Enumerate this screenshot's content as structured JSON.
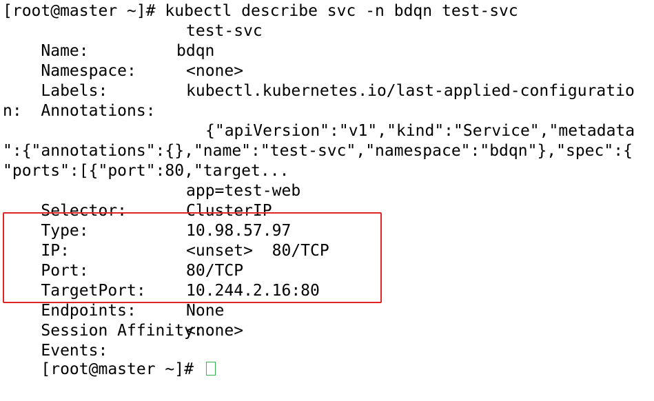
{
  "terminal": {
    "command_line": "[root@master ~]# kubectl describe svc -n bdqn test-svc",
    "fields": {
      "name_label": "Name:",
      "name_value": "test-svc",
      "namespace_label": "Namespace:",
      "namespace_value": "bdqn",
      "labels_label": "Labels:",
      "labels_value": "<none>",
      "annotations_label": "Annotations:",
      "annotations_value": "kubectl.kubernetes.io/last-applied-configuratio",
      "annotations_wrap": "n:",
      "annotation_json_1": "{\"apiVersion\":\"v1\",\"kind\":\"Service\",\"metadata",
      "annotation_json_2": "\":{\"annotations\":{},\"name\":\"test-svc\",\"namespace\":\"bdqn\"},\"spec\":{",
      "annotation_json_3": "\"ports\":[{\"port\":80,\"target...",
      "selector_label": "Selector:",
      "selector_value": "app=test-web",
      "type_label": "Type:",
      "type_value": "ClusterIP",
      "ip_label": "IP:",
      "ip_value": "10.98.57.97",
      "port_label": "Port:",
      "port_value": "<unset>  80/TCP",
      "targetport_label": "TargetPort:",
      "targetport_value": "80/TCP",
      "endpoints_label": "Endpoints:",
      "endpoints_value": "10.244.2.16:80",
      "session_affinity_label": "Session Affinity:",
      "session_affinity_value": "None",
      "events_label": "Events:",
      "events_value": "<none>"
    },
    "prompt": "[root@master ~]# "
  },
  "colors": {
    "background": "#ffffff",
    "text": "#000000",
    "highlight_border": "#e02424",
    "cursor": "#2fb34a"
  }
}
